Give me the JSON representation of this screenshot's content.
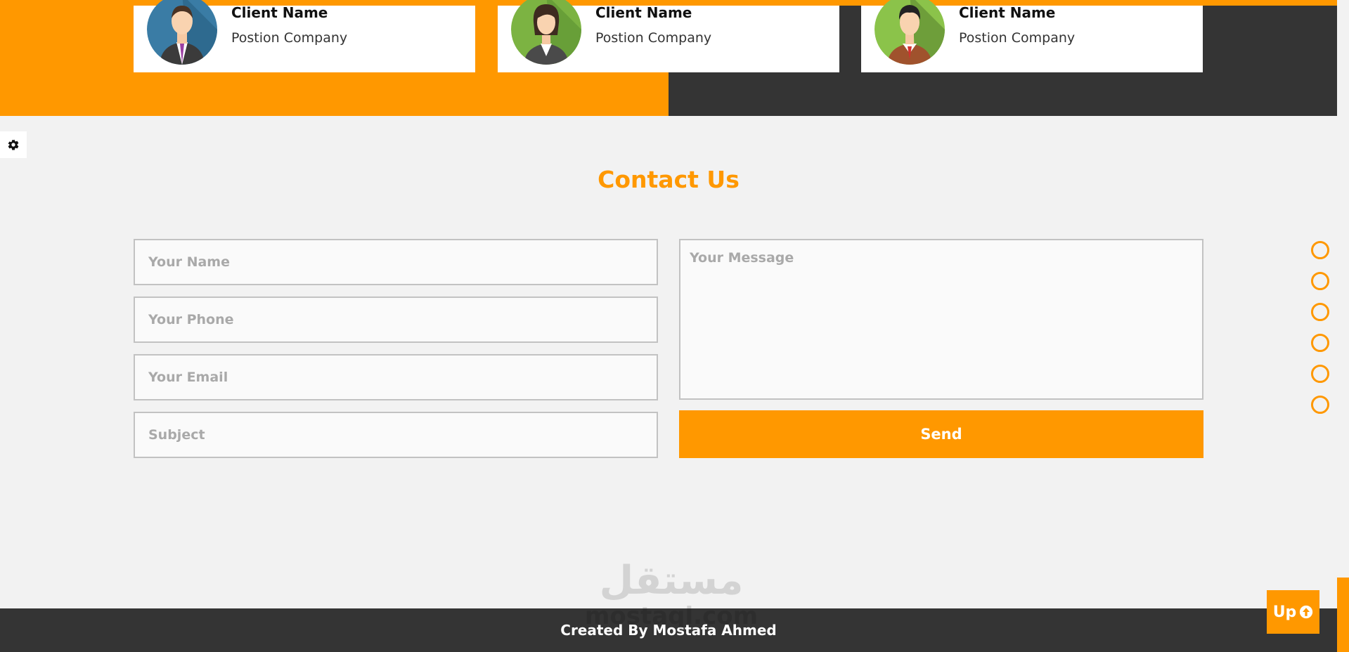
{
  "testimonials": [
    {
      "name": "Client Name",
      "position": "Postion Company",
      "avatar": "businessman-avatar-icon"
    },
    {
      "name": "Client Name",
      "position": "Postion Company",
      "avatar": "businesswoman-avatar-icon"
    },
    {
      "name": "Client Name",
      "position": "Postion Company",
      "avatar": "man-avatar-icon"
    }
  ],
  "contact": {
    "title": "Contact Us",
    "name_placeholder": "Your Name",
    "phone_placeholder": "Your Phone",
    "email_placeholder": "Your Email",
    "subject_placeholder": "Subject",
    "message_placeholder": "Your Message",
    "send_label": "Send"
  },
  "bullets_count": 6,
  "footer": {
    "credit": "Created By Mostafa Ahmed",
    "watermark": "مستقل mostaql.com"
  },
  "up_button": {
    "label": "Up"
  },
  "colors": {
    "accent": "#ff9800",
    "dark": "#343434",
    "background": "#f2f2f2"
  }
}
